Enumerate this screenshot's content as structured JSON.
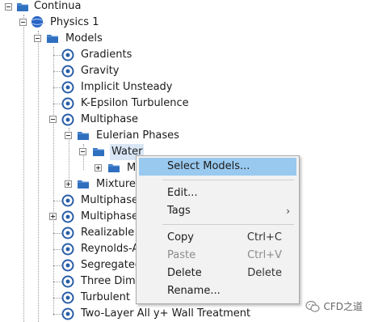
{
  "tree": {
    "items": [
      {
        "label": "Continua",
        "icon": "folder-icon"
      },
      {
        "label": "Physics 1",
        "icon": "physics-continuum-icon"
      },
      {
        "label": "Models",
        "icon": "folder-icon"
      },
      {
        "label": "Gradients",
        "icon": "model-icon"
      },
      {
        "label": "Gravity",
        "icon": "model-icon"
      },
      {
        "label": "Implicit Unsteady",
        "icon": "model-icon"
      },
      {
        "label": "K-Epsilon Turbulence",
        "icon": "model-icon"
      },
      {
        "label": "Multiphase",
        "icon": "model-icon"
      },
      {
        "label": "Eulerian Phases",
        "icon": "folder-icon"
      },
      {
        "label": "Water",
        "icon": "folder-icon"
      },
      {
        "label": "M",
        "icon": "folder-icon"
      },
      {
        "label": "Mixture",
        "icon": "folder-icon"
      },
      {
        "label": "Multiphase",
        "icon": "model-icon"
      },
      {
        "label": "Multiphase",
        "icon": "model-icon"
      },
      {
        "label": "Realizable",
        "icon": "model-icon"
      },
      {
        "label": "Reynolds-A",
        "icon": "model-icon"
      },
      {
        "label": "Segregated",
        "icon": "model-icon"
      },
      {
        "label": "Three Dime",
        "icon": "model-icon"
      },
      {
        "label": "Turbulent",
        "icon": "model-icon"
      },
      {
        "label": "Two-Layer All y+ Wall Treatment",
        "icon": "model-icon"
      }
    ]
  },
  "context_menu": {
    "items": [
      {
        "label": "Select Models...",
        "shortcut": "",
        "highlighted": true,
        "disabled": false
      },
      {
        "label": "Edit...",
        "shortcut": "",
        "disabled": false
      },
      {
        "label": "Tags",
        "shortcut": "",
        "submenu_arrow": "›",
        "disabled": false
      },
      {
        "label": "Copy",
        "shortcut": "Ctrl+C",
        "disabled": false
      },
      {
        "label": "Paste",
        "shortcut": "Ctrl+V",
        "disabled": true
      },
      {
        "label": "Delete",
        "shortcut": "Delete",
        "disabled": false
      },
      {
        "label": "Rename...",
        "shortcut": "",
        "disabled": false
      }
    ]
  },
  "watermark": {
    "text": "CFD之道",
    "icon": "wechat-icon"
  },
  "colors": {
    "folder": "#2f6fbf",
    "model": "#2a5ea8",
    "highlight": "#99c9ef",
    "selection": "#d9e6f5"
  }
}
